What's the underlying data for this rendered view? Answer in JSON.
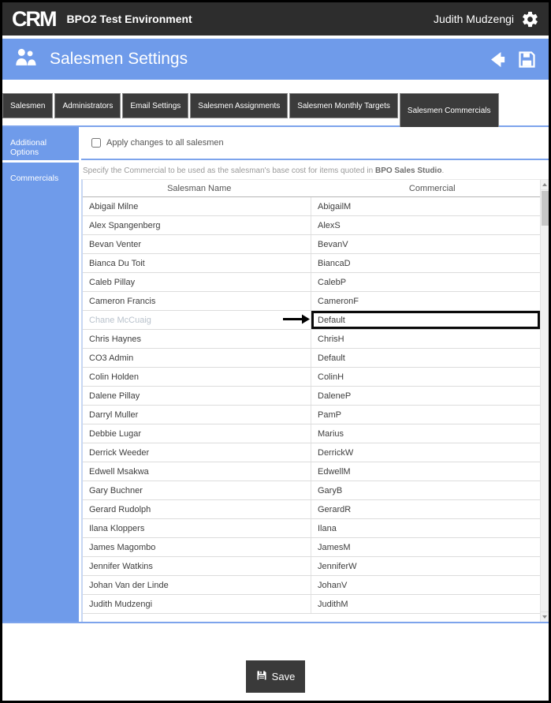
{
  "app": {
    "logo": "CRM",
    "title": "BPO2 Test Environment",
    "user": "Judith Mudzengi"
  },
  "page": {
    "title": "Salesmen Settings"
  },
  "tabs": [
    {
      "label": "Salesmen",
      "active": false
    },
    {
      "label": "Administrators",
      "active": false
    },
    {
      "label": "Email Settings",
      "active": false
    },
    {
      "label": "Salesmen Assignments",
      "active": false
    },
    {
      "label": "Salesmen Monthly Targets",
      "active": false
    },
    {
      "label": "Salesmen Commercials",
      "active": true
    }
  ],
  "sidebar": {
    "items": [
      {
        "label": "Additional Options"
      },
      {
        "label": "Commercials"
      }
    ]
  },
  "main": {
    "apply_all_label": "Apply changes to all salesmen",
    "apply_all_checked": false,
    "description": {
      "prefix": "Specify the Commercial to be used as the salesman's base cost for items quoted in ",
      "bold": "BPO Sales Studio",
      "suffix": "."
    },
    "table": {
      "columns": [
        "Salesman Name",
        "Commercial"
      ],
      "rows": [
        {
          "name": "Abigail Milne",
          "commercial": "AbigailM"
        },
        {
          "name": "Alex Spangenberg",
          "commercial": "AlexS"
        },
        {
          "name": "Bevan Venter",
          "commercial": "BevanV"
        },
        {
          "name": "Bianca Du Toit",
          "commercial": "BiancaD"
        },
        {
          "name": "Caleb Pillay",
          "commercial": "CalebP"
        },
        {
          "name": "Cameron Francis",
          "commercial": "CameronF"
        },
        {
          "name": "Chane McCuaig",
          "commercial": "Default",
          "disabled": true,
          "highlighted": true
        },
        {
          "name": "Chris Haynes",
          "commercial": "ChrisH"
        },
        {
          "name": "CO3 Admin",
          "commercial": "Default"
        },
        {
          "name": "Colin Holden",
          "commercial": "ColinH"
        },
        {
          "name": "Dalene Pillay",
          "commercial": "DaleneP"
        },
        {
          "name": "Darryl Muller",
          "commercial": "PamP"
        },
        {
          "name": "Debbie Lugar",
          "commercial": "Marius"
        },
        {
          "name": "Derrick Weeder",
          "commercial": "DerrickW"
        },
        {
          "name": "Edwell Msakwa",
          "commercial": "EdwellM"
        },
        {
          "name": "Gary Buchner",
          "commercial": "GaryB"
        },
        {
          "name": "Gerard Rudolph",
          "commercial": "GerardR"
        },
        {
          "name": "Ilana Kloppers",
          "commercial": "Ilana"
        },
        {
          "name": "James Magombo",
          "commercial": "JamesM"
        },
        {
          "name": "Jennifer Watkins",
          "commercial": "JenniferW"
        },
        {
          "name": "Johan Van der Linde",
          "commercial": "JohanV"
        },
        {
          "name": "Judith Mudzengi",
          "commercial": "JudithM"
        }
      ]
    }
  },
  "footer": {
    "save_label": "Save"
  },
  "icons": {
    "settings": "gear-icon",
    "page_header": "salesmen-people-icon",
    "back": "back-arrow-icon",
    "header_save": "save-floppy-icon",
    "row_annotation": "black-arrow-annotation",
    "footer_save": "save-floppy-icon"
  },
  "colors": {
    "accent_blue": "#6F9BEA",
    "separator_blue": "#7DA4EC",
    "dark_bar": "#2D2D2D",
    "tab_dark": "#3B3B3B",
    "disabled_text": "#B9C2CC",
    "highlight_border": "#000000"
  }
}
